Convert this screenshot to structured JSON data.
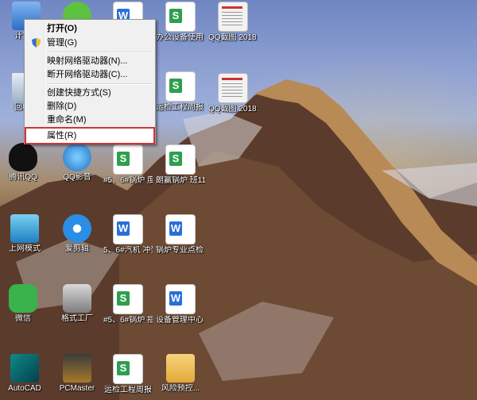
{
  "desktop": {
    "icons": [
      {
        "label": "计算机",
        "kind": "computer"
      },
      {
        "label": "",
        "kind": "app-green"
      },
      {
        "label": "",
        "kind": "doc-blue"
      },
      {
        "label": "办公设备使用 情况登记表...",
        "kind": "doc-green"
      },
      {
        "label": "QQ截图 20181105...",
        "kind": "thumb"
      },
      {
        "label": "回收站",
        "kind": "recycle"
      },
      {
        "label": "运检工程周报 2018年...",
        "kind": "doc-green"
      },
      {
        "label": "QQ截图 20181105...",
        "kind": "thumb"
      },
      {
        "label": "腾讯QQ",
        "kind": "qq"
      },
      {
        "label": "QQ影音",
        "kind": "qqplayer"
      },
      {
        "label": "#5、6#锅炉 度测量记录...",
        "kind": "doc-green"
      },
      {
        "label": "朗赢锅炉 班11月度...",
        "kind": "doc-green"
      },
      {
        "label": "上网模式",
        "kind": "app-blue"
      },
      {
        "label": "爱剪辑",
        "kind": "app-circle"
      },
      {
        "label": "5、6#汽机 冲架及保护...",
        "kind": "doc-blue"
      },
      {
        "label": "锅炉专业点检 周报2018...",
        "kind": "doc-blue"
      },
      {
        "label": "微信",
        "kind": "wechat"
      },
      {
        "label": "格式工厂",
        "kind": "app-tool"
      },
      {
        "label": "#5、6#锅炉 指示器记录...",
        "kind": "doc-green"
      },
      {
        "label": "设备管理中心 2018...",
        "kind": "doc-blue"
      },
      {
        "label": "AutoCAD",
        "kind": "autocad"
      },
      {
        "label": "PCMaster",
        "kind": "pcmaster"
      },
      {
        "label": "运检工程周报",
        "kind": "doc-green"
      },
      {
        "label": "风险预控...",
        "kind": "folder"
      }
    ]
  },
  "context_menu": {
    "items": [
      {
        "label": "打开(O)",
        "bold": true
      },
      {
        "label": "管理(G)",
        "icon": "shield-icon"
      },
      {
        "label": "映射网络驱动器(N)..."
      },
      {
        "label": "断开网络驱动器(C)..."
      },
      {
        "label": "创建快捷方式(S)"
      },
      {
        "label": "删除(D)"
      },
      {
        "label": "重命名(M)"
      },
      {
        "label": "属性(R)",
        "highlighted": true
      }
    ],
    "highlight_color": "#d0343a"
  }
}
